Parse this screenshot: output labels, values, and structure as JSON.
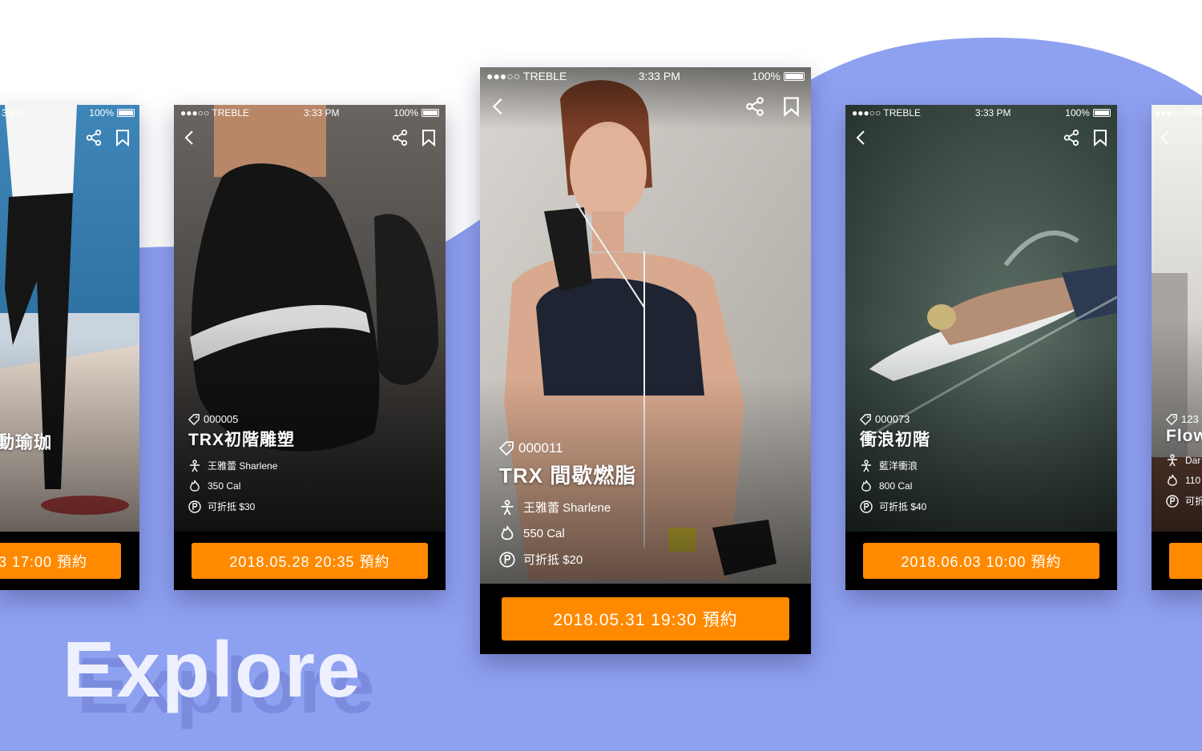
{
  "headline": "Explore",
  "accent_color": "#ff8a00",
  "wave_color": "#8ea0f0",
  "status_bar": {
    "carrier": "●●●○○ TREBLE",
    "time": "3:33 PM",
    "battery": "100%"
  },
  "status_bar_partial": {
    "time": "3 PM",
    "carrier": "●●●○○ TRE"
  },
  "icons": {
    "back": "chevron-left-icon",
    "share": "share-icon",
    "bookmark": "bookmark-icon",
    "tag": "tag-icon",
    "trainer": "person-icon",
    "calories": "flame-icon",
    "points": "points-icon"
  },
  "cards": [
    {
      "title": "動瑜珈",
      "button": "3 17:00 預約"
    },
    {
      "code": "000005",
      "title": "TRX初階雕塑",
      "trainer": "王雅蕾 Sharlene",
      "calories": "350 Cal",
      "discount": "可折抵 $30",
      "button": "2018.05.28 20:35 預約"
    },
    {
      "code": "000011",
      "title": "TRX 間歇燃脂",
      "trainer": "王雅蕾 Sharlene",
      "calories": "550 Cal",
      "discount": "可折抵 $20",
      "button": "2018.05.31 19:30 預約"
    },
    {
      "code": "000073",
      "title": "衝浪初階",
      "trainer": "藍洋衝浪",
      "calories": "800 Cal",
      "discount": "可折抵 $40",
      "button": "2018.06.03 10:00 預約"
    },
    {
      "code": "123",
      "title": "Flow",
      "trainer": "Dar",
      "calories": "110",
      "discount": "可折"
    }
  ]
}
